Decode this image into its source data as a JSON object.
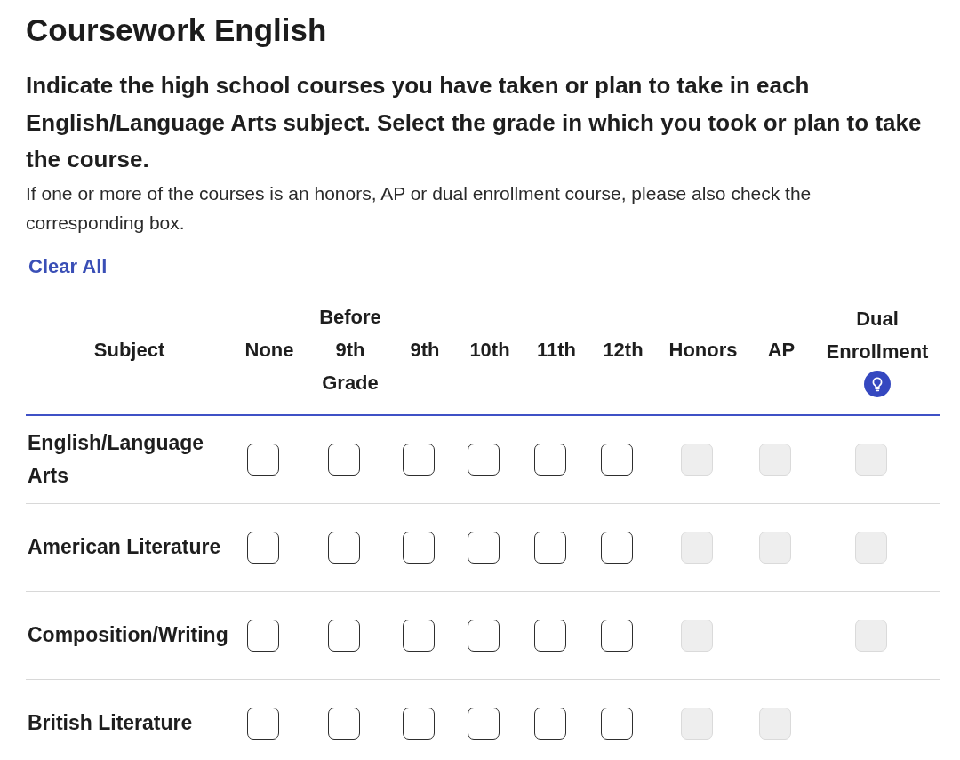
{
  "title": "Coursework English",
  "instructions": "Indicate the high school courses you have taken or plan to take in each English/Language Arts subject. Select the grade in which you took or plan to take the course.",
  "note": "If one or more of the courses is an honors, AP or dual enrollment course, please also check the corresponding box.",
  "clear_all": "Clear All",
  "columns": [
    {
      "label": "Subject",
      "hint": false
    },
    {
      "label": "None",
      "hint": false
    },
    {
      "label": "Before 9th Grade",
      "hint": false
    },
    {
      "label": "9th",
      "hint": false
    },
    {
      "label": "10th",
      "hint": false
    },
    {
      "label": "11th",
      "hint": false
    },
    {
      "label": "12th",
      "hint": false
    },
    {
      "label": "Honors",
      "hint": false
    },
    {
      "label": "AP",
      "hint": false
    },
    {
      "label": "Dual Enrollment",
      "hint": true
    }
  ],
  "rows": [
    {
      "subject": "English/Language Arts",
      "cells": [
        {
          "kind": "checkbox",
          "checked": false,
          "disabled": false
        },
        {
          "kind": "checkbox",
          "checked": false,
          "disabled": false
        },
        {
          "kind": "checkbox",
          "checked": false,
          "disabled": false
        },
        {
          "kind": "checkbox",
          "checked": false,
          "disabled": false
        },
        {
          "kind": "checkbox",
          "checked": false,
          "disabled": false
        },
        {
          "kind": "checkbox",
          "checked": false,
          "disabled": false
        },
        {
          "kind": "checkbox",
          "checked": false,
          "disabled": true
        },
        {
          "kind": "checkbox",
          "checked": false,
          "disabled": true
        },
        {
          "kind": "checkbox",
          "checked": false,
          "disabled": true
        }
      ]
    },
    {
      "subject": "American Literature",
      "cells": [
        {
          "kind": "checkbox",
          "checked": false,
          "disabled": false
        },
        {
          "kind": "checkbox",
          "checked": false,
          "disabled": false
        },
        {
          "kind": "checkbox",
          "checked": false,
          "disabled": false
        },
        {
          "kind": "checkbox",
          "checked": false,
          "disabled": false
        },
        {
          "kind": "checkbox",
          "checked": false,
          "disabled": false
        },
        {
          "kind": "checkbox",
          "checked": false,
          "disabled": false
        },
        {
          "kind": "checkbox",
          "checked": false,
          "disabled": true
        },
        {
          "kind": "checkbox",
          "checked": false,
          "disabled": true
        },
        {
          "kind": "checkbox",
          "checked": false,
          "disabled": true
        }
      ]
    },
    {
      "subject": "Composition/Writing",
      "cells": [
        {
          "kind": "checkbox",
          "checked": false,
          "disabled": false
        },
        {
          "kind": "checkbox",
          "checked": false,
          "disabled": false
        },
        {
          "kind": "checkbox",
          "checked": false,
          "disabled": false
        },
        {
          "kind": "checkbox",
          "checked": false,
          "disabled": false
        },
        {
          "kind": "checkbox",
          "checked": false,
          "disabled": false
        },
        {
          "kind": "checkbox",
          "checked": false,
          "disabled": false
        },
        {
          "kind": "checkbox",
          "checked": false,
          "disabled": true
        },
        {
          "kind": "empty"
        },
        {
          "kind": "checkbox",
          "checked": false,
          "disabled": true
        }
      ]
    },
    {
      "subject": "British Literature",
      "cells": [
        {
          "kind": "checkbox",
          "checked": false,
          "disabled": false
        },
        {
          "kind": "checkbox",
          "checked": false,
          "disabled": false
        },
        {
          "kind": "checkbox",
          "checked": false,
          "disabled": false
        },
        {
          "kind": "checkbox",
          "checked": false,
          "disabled": false
        },
        {
          "kind": "checkbox",
          "checked": false,
          "disabled": false
        },
        {
          "kind": "checkbox",
          "checked": false,
          "disabled": false
        },
        {
          "kind": "checkbox",
          "checked": false,
          "disabled": true
        },
        {
          "kind": "checkbox",
          "checked": false,
          "disabled": true
        },
        {
          "kind": "empty"
        }
      ]
    }
  ]
}
